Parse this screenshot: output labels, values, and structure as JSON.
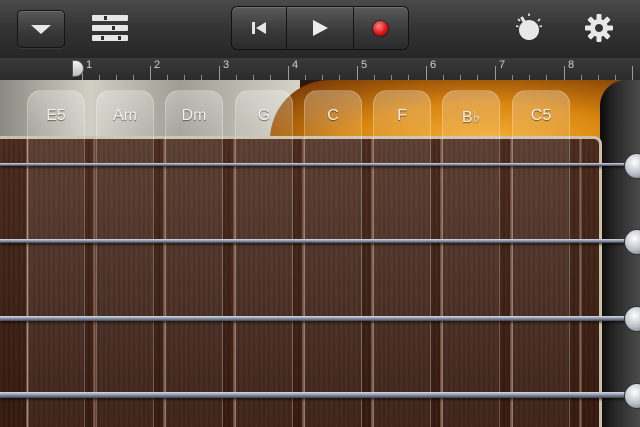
{
  "ruler": {
    "numbers": [
      "1",
      "2",
      "3",
      "4",
      "5",
      "6",
      "7",
      "8"
    ]
  },
  "chords": [
    "E5",
    "Am",
    "Dm",
    "G",
    "C",
    "F",
    "B♭",
    "C5"
  ],
  "colors": {
    "record": "#e01414",
    "body_sunburst": "#e3900f",
    "fretboard": "#3e2216"
  },
  "icons": {
    "menu": "dropdown-triangle-icon",
    "tracks": "tracks-view-icon",
    "rewind": "go-to-beginning-icon",
    "play": "play-icon",
    "record": "record-icon",
    "metronome": "metronome-knob-icon",
    "settings": "gear-icon"
  }
}
